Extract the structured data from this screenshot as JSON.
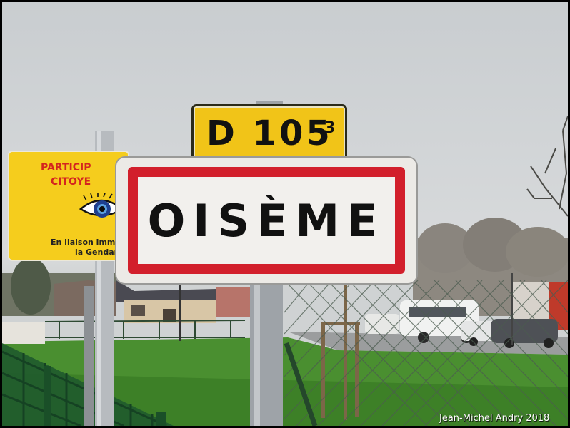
{
  "road_sign": {
    "number": "D 105",
    "superscript": "3"
  },
  "town_sign": {
    "name": "OISÈME"
  },
  "citizen_sign": {
    "title_line1": "PARTICIP",
    "title_line2": "CITOYE",
    "subtitle_line1": "En liaison immé",
    "subtitle_line2": "la Gendar"
  },
  "photo_credit": "Jean-Michel Andry 2018",
  "colors": {
    "road_plate_yellow": "#f1c418",
    "town_border_red": "#d21f2b",
    "citizen_sign_yellow": "#f5cd1d",
    "sky": "#d3d6d8",
    "grass": "#3f8a2c"
  },
  "icons": [
    "eye-icon"
  ]
}
